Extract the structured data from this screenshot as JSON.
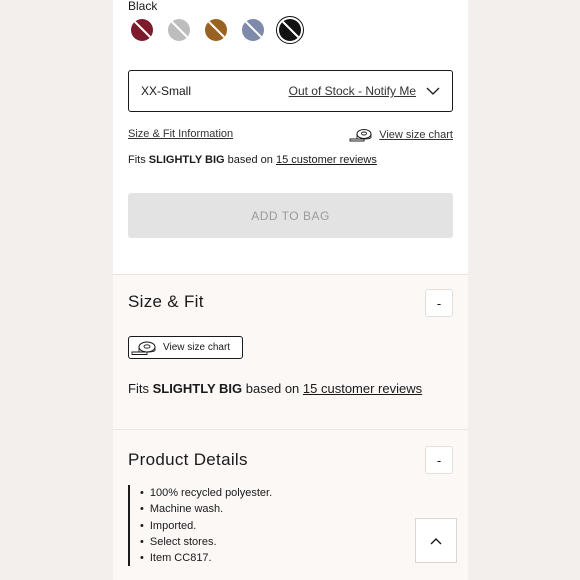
{
  "color": {
    "selected_label": "Black",
    "swatches": [
      {
        "name": "burgundy",
        "hex": "#7d1a2c",
        "selected": false
      },
      {
        "name": "light-gray",
        "hex": "#bdbdbd",
        "selected": false
      },
      {
        "name": "brown",
        "hex": "#9a6220",
        "selected": false
      },
      {
        "name": "slate-blue",
        "hex": "#7d8aa9",
        "selected": false
      },
      {
        "name": "black",
        "hex": "#111111",
        "selected": true
      }
    ]
  },
  "size_select": {
    "value": "XX-Small",
    "status": "Out of Stock - Notify Me",
    "icon": "chevron-down-icon"
  },
  "links": {
    "fit_info": "Size & Fit Information",
    "view_size_chart": "View size chart",
    "tape_icon": "tape-measure-icon"
  },
  "fit_summary": {
    "prefix": "Fits",
    "verdict": "SLIGHTLY BIG",
    "middle": "based on",
    "reviews": "15 customer reviews"
  },
  "add_to_bag": "ADD TO BAG",
  "size_fit_panel": {
    "title": "Size & Fit",
    "toggle": "-",
    "chart_button": "View size chart"
  },
  "product_details": {
    "title": "Product Details",
    "toggle": "-",
    "items": [
      "100% recycled polyester.",
      "Machine wash.",
      "Imported.",
      "Select stores.",
      "Item CC817."
    ]
  },
  "scroll_top_icon": "chevron-up-icon"
}
